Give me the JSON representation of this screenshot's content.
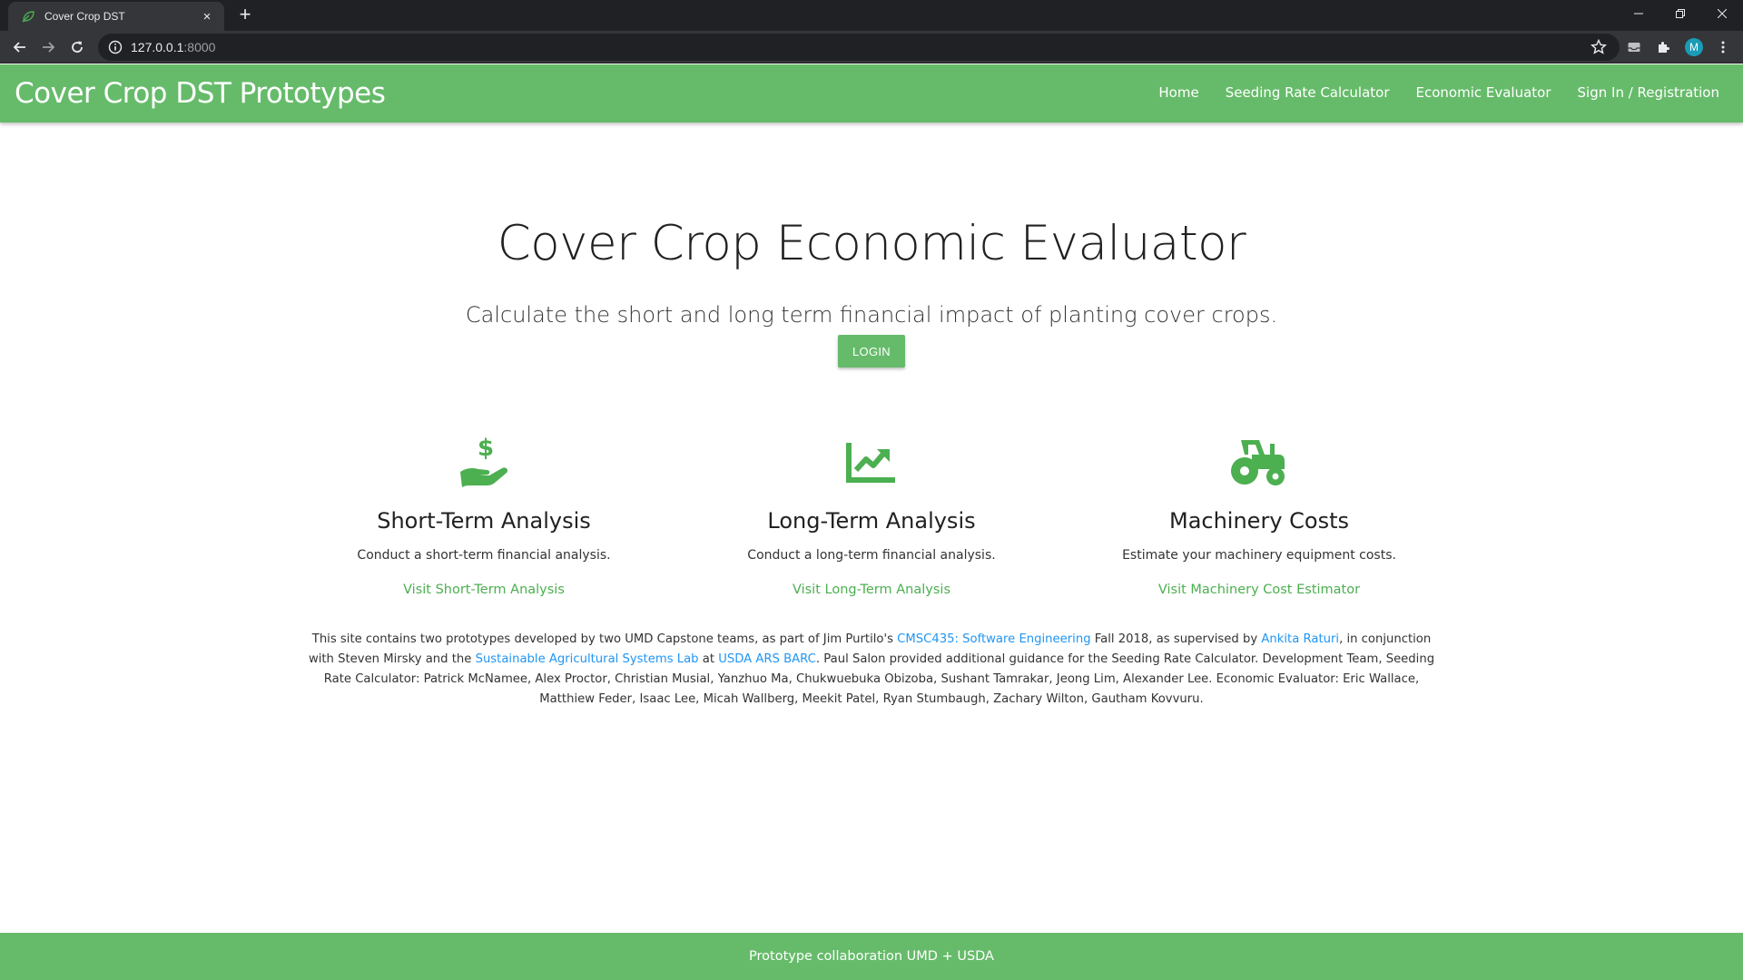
{
  "browser": {
    "tab_title": "Cover Crop DST",
    "url_host": "127.0.0.1",
    "url_port": ":8000",
    "profile_initial": "M",
    "new_tab": "+",
    "close": "×"
  },
  "navbar": {
    "brand": "Cover Crop DST Prototypes",
    "links": [
      "Home",
      "Seeding Rate Calculator",
      "Economic Evaluator",
      "Sign In / Registration"
    ]
  },
  "hero": {
    "title": "Cover Crop Economic Evaluator",
    "subtitle": "Calculate the short and long term financial impact of planting cover crops.",
    "login_label": "LOGIN"
  },
  "features": [
    {
      "icon": "hand-dollar-icon",
      "title": "Short-Term Analysis",
      "description": "Conduct a short-term financial analysis.",
      "link": "Visit Short-Term Analysis"
    },
    {
      "icon": "trending-up-chart-icon",
      "title": "Long-Term Analysis",
      "description": "Conduct a long-term financial analysis.",
      "link": "Visit Long-Term Analysis"
    },
    {
      "icon": "tractor-icon",
      "title": "Machinery Costs",
      "description": "Estimate your machinery equipment costs.",
      "link": "Visit Machinery Cost Estimator"
    }
  ],
  "about": {
    "t1": "This site contains two prototypes developed by two UMD Capstone teams, as part of Jim Purtilo's ",
    "l1": "CMSC435: Software Engineering",
    "t2": " Fall 2018, as supervised by ",
    "l2": "Ankita Raturi",
    "t3": ", in conjunction with Steven Mirsky and the ",
    "l3": "Sustainable Agricultural Systems Lab",
    "t4": " at ",
    "l4": "USDA ARS BARC",
    "t5": ". Paul Salon provided additional guidance for the Seeding Rate Calculator. Development Team, Seeding Rate Calculator: Patrick McNamee, Alex Proctor, Christian Musial, Yanzhuo Ma, Chukwuebuka Obizoba, Sushant Tamrakar, Jeong Lim, Alexander Lee. Economic Evaluator: Eric Wallace, Matthiew Feder, Isaac Lee, Micah Wallberg, Meekit Patel, Ryan Stumbaugh, Zachary Wilton, Gautham Kovvuru."
  },
  "footer": {
    "text": "Prototype collaboration UMD + USDA"
  },
  "colors": {
    "brand_green": "#66bb6a",
    "icon_green": "#4caf50",
    "link_blue": "#2196f3"
  }
}
